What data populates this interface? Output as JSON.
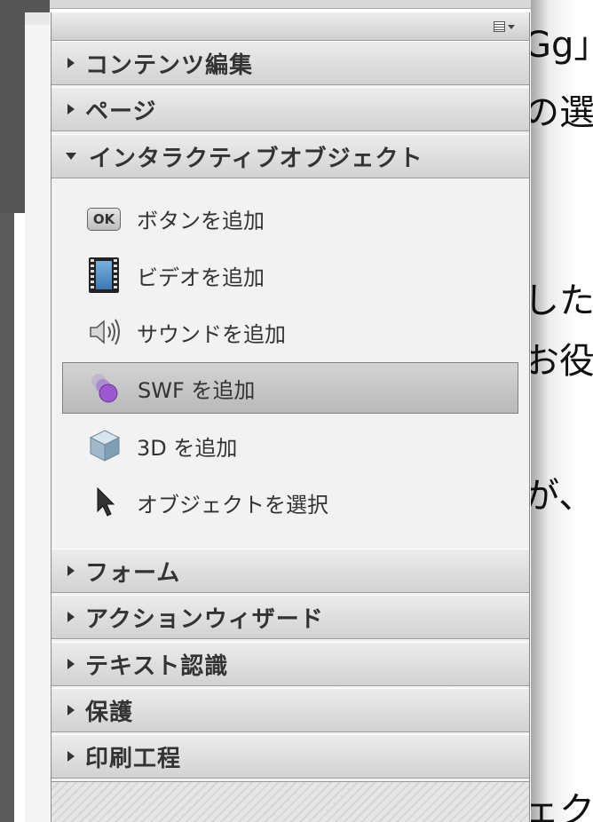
{
  "document": {
    "lines": [
      "Gg」",
      "の選択",
      "した",
      "お役",
      "が、",
      "ェク"
    ]
  },
  "panel": {
    "sections_top": [
      {
        "label": "コンテンツ編集",
        "expanded": false
      },
      {
        "label": "ページ",
        "expanded": false
      },
      {
        "label": "インタラクティブオブジェクト",
        "expanded": true
      }
    ],
    "tools": [
      {
        "label": "ボタンを追加",
        "icon": "ok-button-icon",
        "icon_text": "OK",
        "selected": false
      },
      {
        "label": "ビデオを追加",
        "icon": "film-icon",
        "selected": false
      },
      {
        "label": "サウンドを追加",
        "icon": "speaker-icon",
        "selected": false
      },
      {
        "label": "SWF を追加",
        "icon": "swf-icon",
        "selected": true
      },
      {
        "label": "3D を追加",
        "icon": "cube-icon",
        "selected": false
      },
      {
        "label": "オブジェクトを選択",
        "icon": "arrow-pointer-icon",
        "selected": false
      }
    ],
    "sections_bottom": [
      {
        "label": "フォーム",
        "expanded": false
      },
      {
        "label": "アクションウィザード",
        "expanded": false
      },
      {
        "label": "テキスト認識",
        "expanded": false
      },
      {
        "label": "保護",
        "expanded": false
      },
      {
        "label": "印刷工程",
        "expanded": false
      }
    ]
  },
  "colors": {
    "selected_bg": "#c4c4c4",
    "header_text": "#333333",
    "swf_purple": "#9b59d0"
  }
}
